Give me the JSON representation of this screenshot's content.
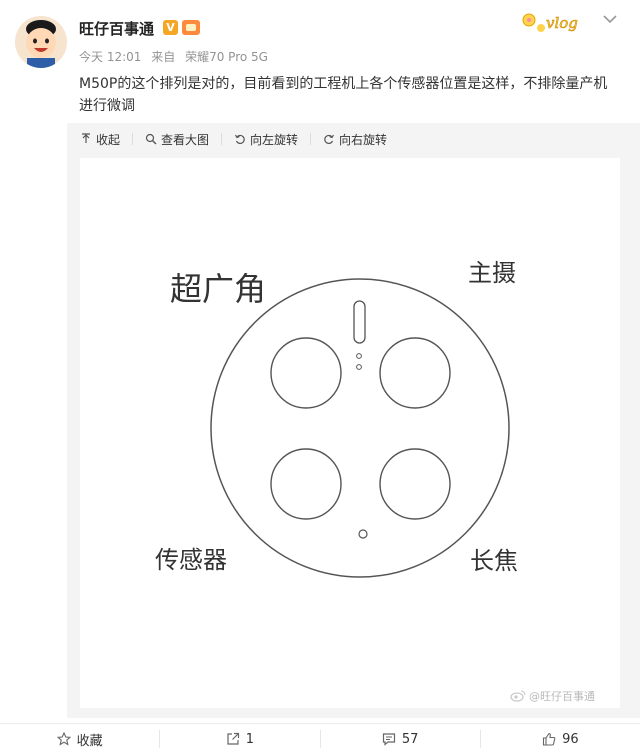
{
  "author": {
    "name": "旺仔百事通"
  },
  "post": {
    "time": "今天 12:01",
    "source_prefix": "来自",
    "device": "荣耀70 Pro 5G",
    "text": "M50P的这个排列是对的，目前看到的工程机上各个传感器位置是这样，不排除量产机进行微调"
  },
  "toolbar": {
    "collapse": "收起",
    "view_large": "查看大图",
    "rotate_left": "向左旋转",
    "rotate_right": "向右旋转"
  },
  "image": {
    "labels": {
      "ultra_wide": "超广角",
      "main": "主摄",
      "sensor": "传感器",
      "tele": "长焦"
    },
    "watermark": "@旺仔百事通",
    "badge": "vlog"
  },
  "footer": {
    "favorite": "收藏",
    "repost_count": "1",
    "comment_count": "57",
    "like_count": "96"
  },
  "colors": {
    "accent": "#f5a623",
    "text": "#333333",
    "muted": "#939393",
    "panel": "#f4f4f4"
  }
}
